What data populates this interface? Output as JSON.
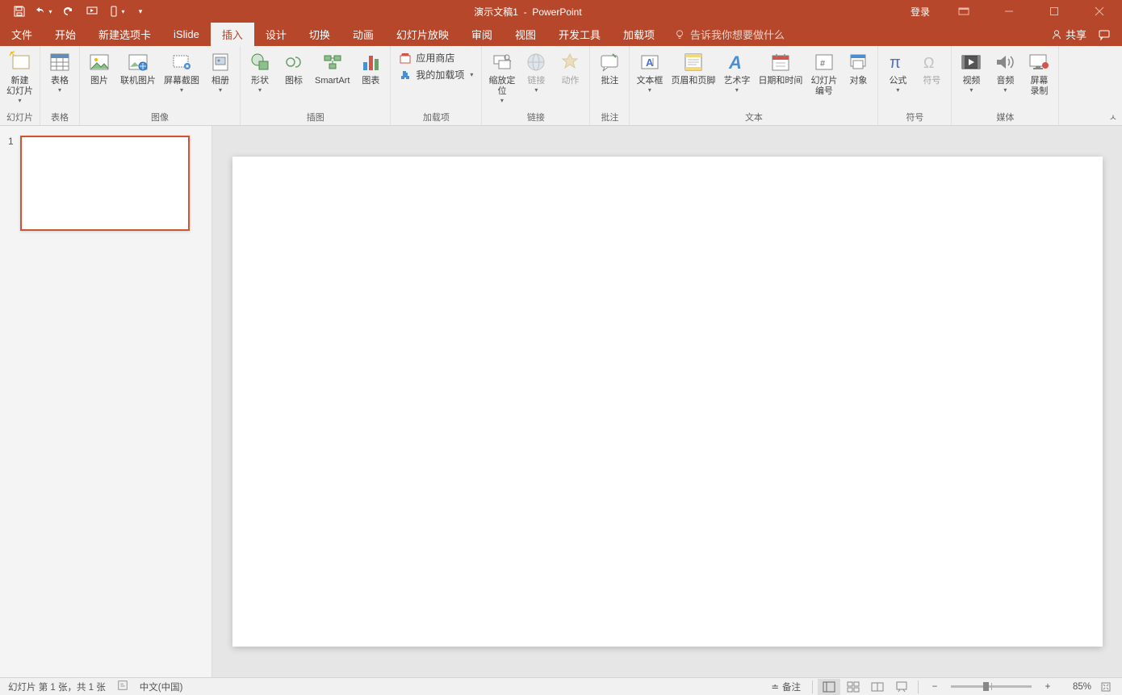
{
  "title": {
    "doc": "演示文稿1",
    "sep": "-",
    "app": "PowerPoint"
  },
  "titlebar": {
    "login": "登录"
  },
  "tabs": {
    "file": "文件",
    "home": "开始",
    "newtab": "新建选项卡",
    "islide": "iSlide",
    "insert": "插入",
    "design": "设计",
    "transition": "切换",
    "animation": "动画",
    "slideshow": "幻灯片放映",
    "review": "审阅",
    "view": "视图",
    "devtools": "开发工具",
    "addins": "加载项"
  },
  "tellme": "告诉我你想要做什么",
  "share": "共享",
  "ribbon": {
    "groups": {
      "slide": "幻灯片",
      "table": "表格",
      "image": "图像",
      "illustration": "插图",
      "addin": "加载项",
      "link": "链接",
      "comment": "批注",
      "text": "文本",
      "symbol": "符号",
      "media": "媒体"
    },
    "buttons": {
      "newslide": "新建\n幻灯片",
      "table": "表格",
      "picture": "图片",
      "onlinepic": "联机图片",
      "screenshot": "屏幕截图",
      "album": "相册",
      "shape": "形状",
      "icon": "图标",
      "smartart": "SmartArt",
      "chart": "图表",
      "appstore": "应用商店",
      "myaddins": "我的加载项",
      "zoom": "缩放定\n位",
      "hyperlink": "链接",
      "action": "动作",
      "comment": "批注",
      "textbox": "文本框",
      "headerfooter": "页眉和页脚",
      "wordart": "艺术字",
      "datetime": "日期和时间",
      "slidenum": "幻灯片\n编号",
      "object": "对象",
      "equation": "公式",
      "symbol": "符号",
      "video": "视频",
      "audio": "音频",
      "screenrec": "屏幕\n录制"
    }
  },
  "thumb": {
    "num": "1"
  },
  "status": {
    "slideinfo": "幻灯片 第 1 张，共 1 张",
    "language": "中文(中国)",
    "notes": "备注",
    "zoom": "85%"
  }
}
